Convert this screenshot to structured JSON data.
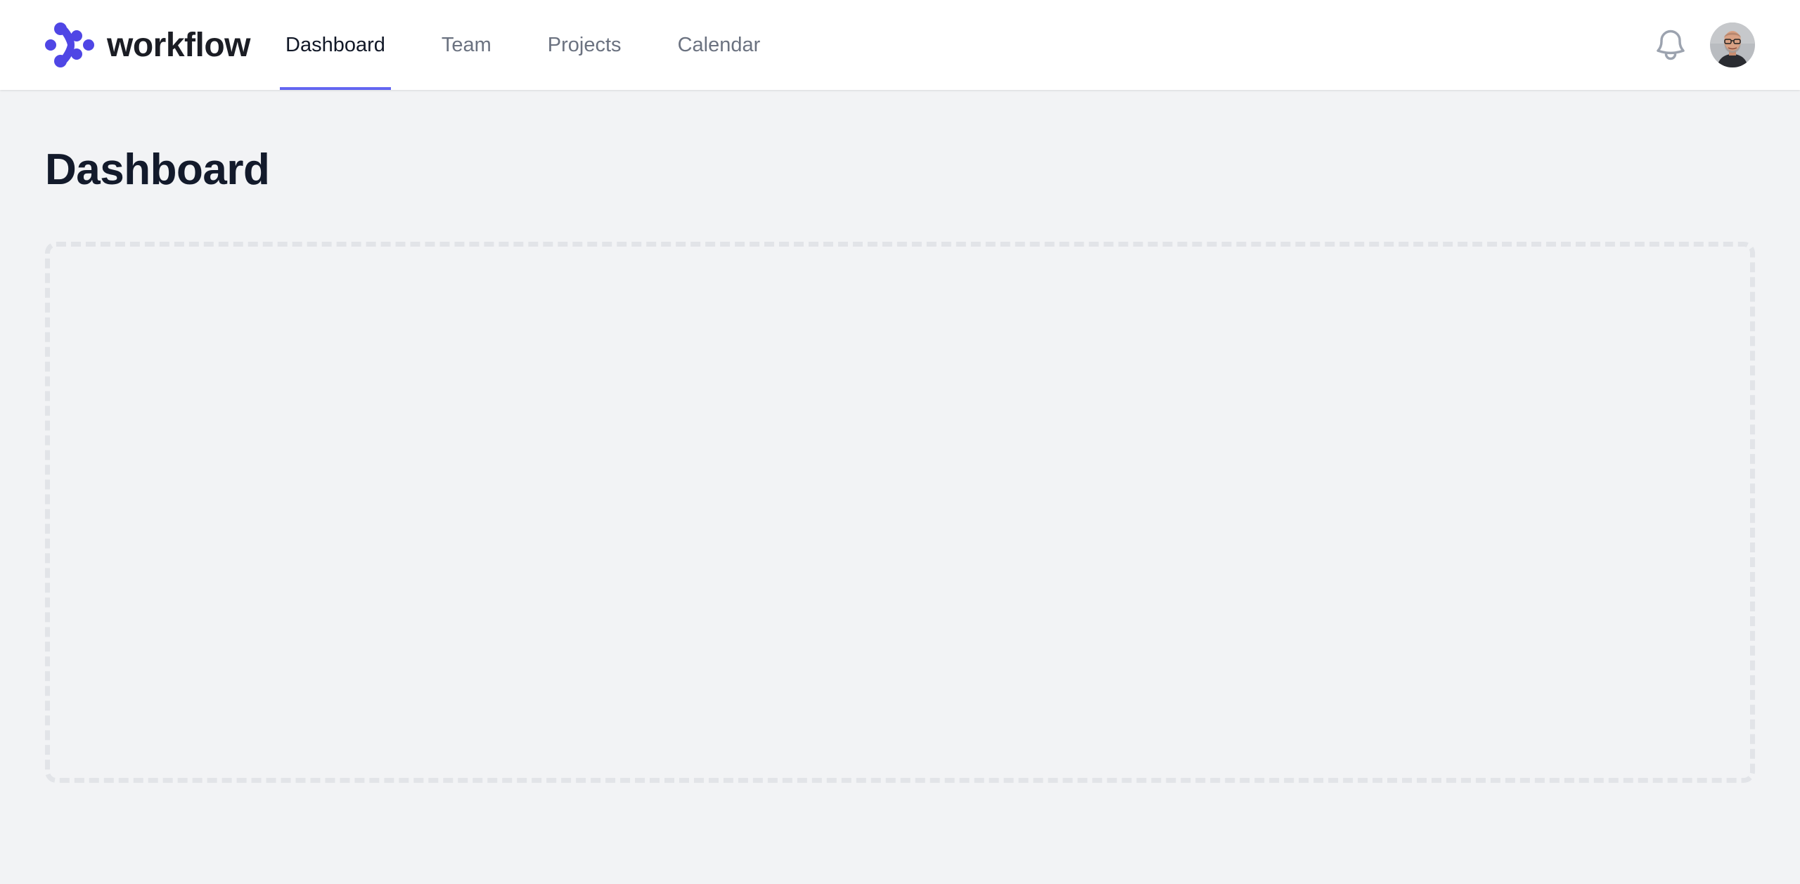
{
  "brand": {
    "name": "workflow",
    "logo_icon": "workflow-logo-icon",
    "color": "#4f46e5"
  },
  "nav": {
    "tabs": [
      {
        "label": "Dashboard",
        "active": true
      },
      {
        "label": "Team",
        "active": false
      },
      {
        "label": "Projects",
        "active": false
      },
      {
        "label": "Calendar",
        "active": false
      }
    ],
    "active_color": "#6366f1"
  },
  "header": {
    "notification_icon": "bell-icon",
    "avatar_icon": "user-avatar"
  },
  "main": {
    "title": "Dashboard"
  }
}
